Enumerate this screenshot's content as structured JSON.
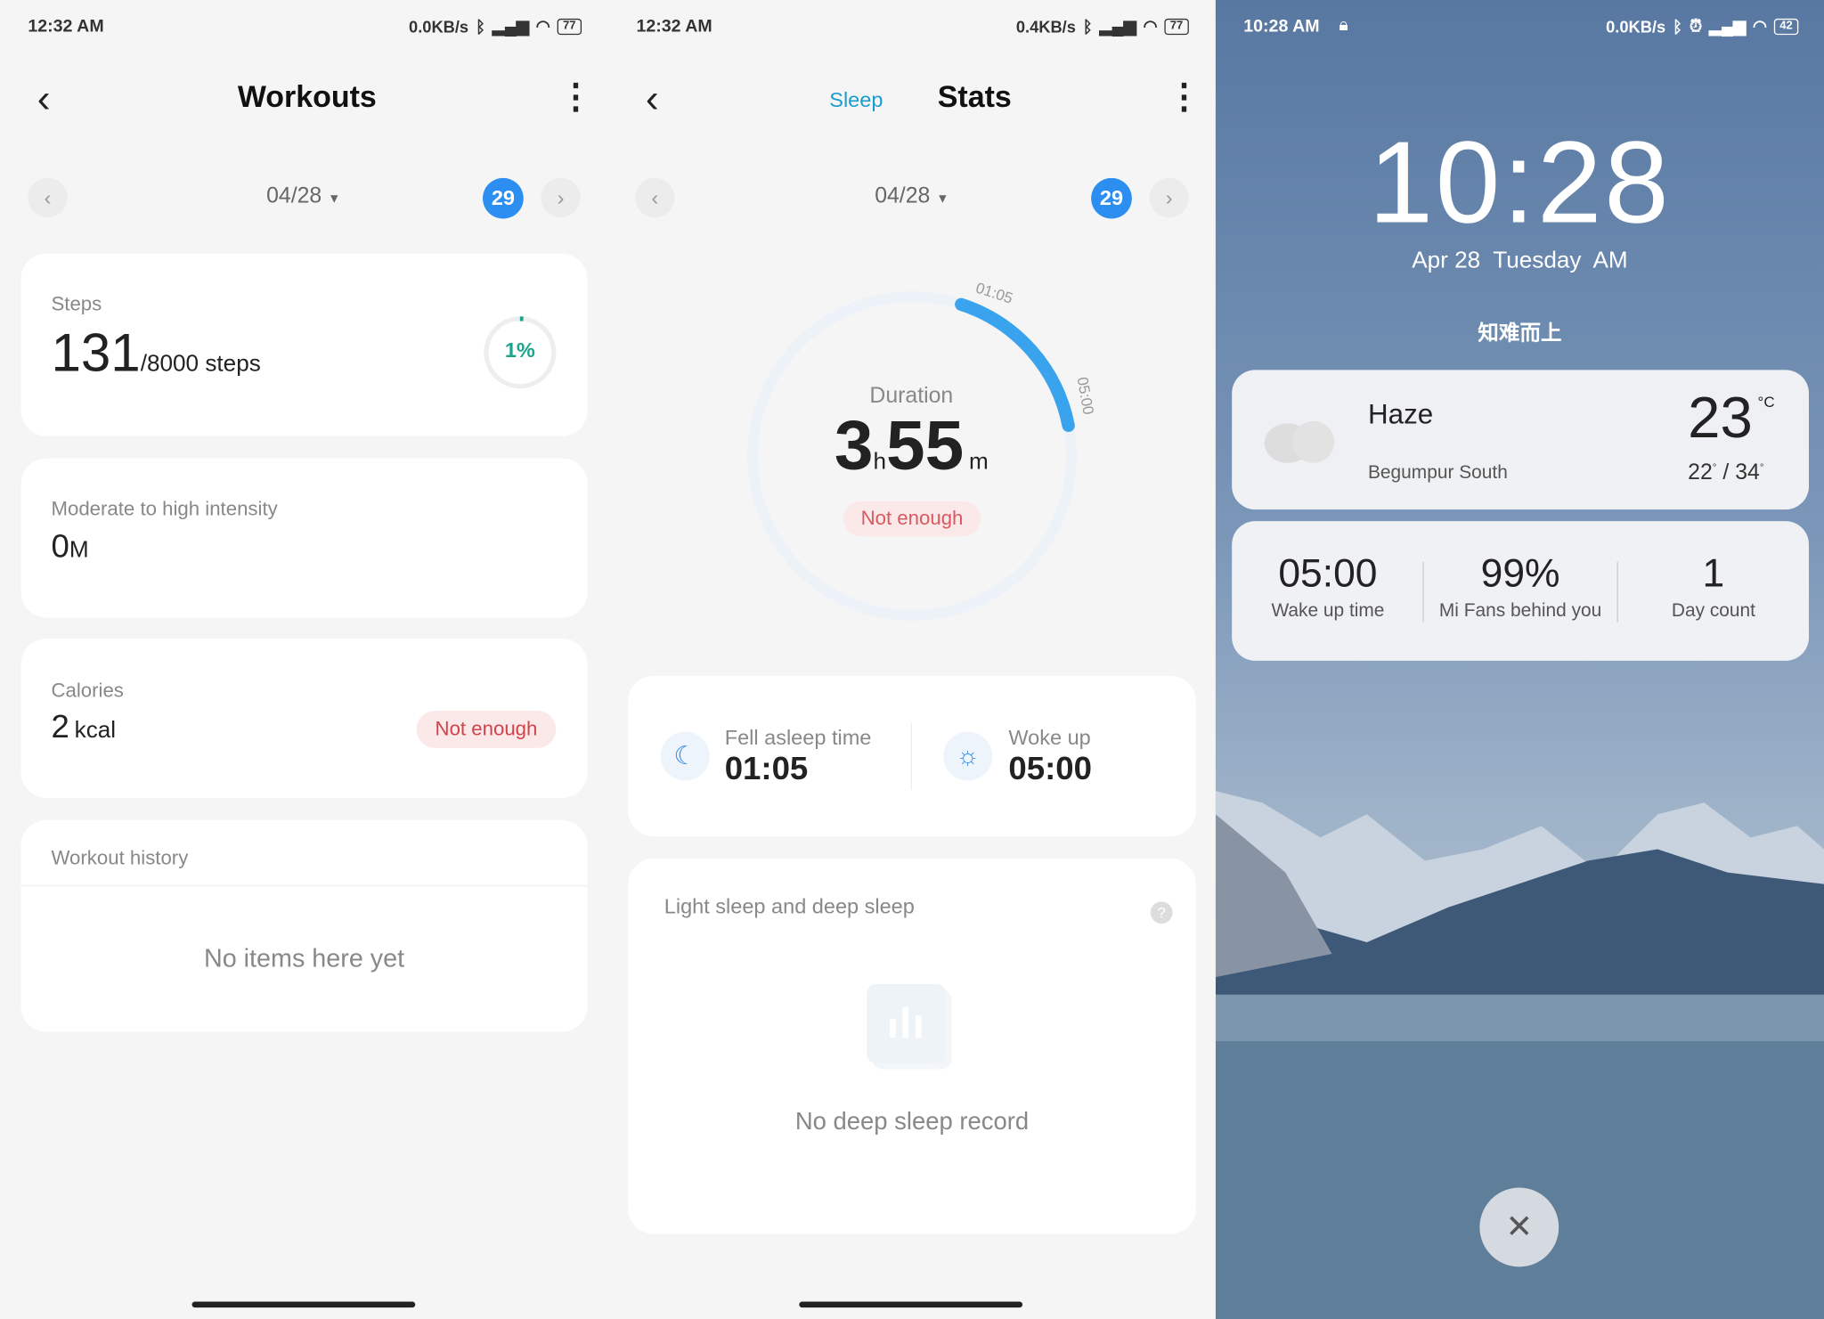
{
  "workouts": {
    "status": {
      "time": "12:32 AM",
      "speed": "0.0KB/s",
      "battery": "77"
    },
    "title": "Workouts",
    "date": "04/28",
    "day": "29",
    "steps": {
      "label": "Steps",
      "value": "131",
      "goal": "/8000 steps",
      "percent_label": "1%",
      "progress": 0.016
    },
    "intensity": {
      "label": "Moderate to high intensity",
      "value": "0",
      "unit": "M"
    },
    "calories": {
      "label": "Calories",
      "value": "2",
      "unit": "kcal",
      "badge": "Not enough"
    },
    "history": {
      "label": "Workout history",
      "empty": "No items here yet"
    }
  },
  "sleep": {
    "status": {
      "time": "12:32 AM",
      "speed": "0.4KB/s",
      "battery": "77"
    },
    "tab_sleep": "Sleep",
    "title": "Stats",
    "date": "04/28",
    "day": "29",
    "ring": {
      "start_label": "01:05",
      "end_label": "05:00",
      "duration_label": "Duration",
      "hours": "3",
      "h": "h",
      "minutes": "55",
      "m": "m",
      "badge": "Not enough"
    },
    "fell_asleep": {
      "label": "Fell asleep time",
      "value": "01:05"
    },
    "woke_up": {
      "label": "Woke up",
      "value": "05:00"
    },
    "deep": {
      "label": "Light sleep and deep sleep",
      "help": "?",
      "empty": "No deep sleep record"
    },
    "accent": "#2b8ef0"
  },
  "lock": {
    "status": {
      "time": "10:28 AM",
      "speed": "0.0KB/s",
      "battery": "42"
    },
    "clock": "10:28",
    "date": "Apr 28  Tuesday  AM",
    "motto": "知难而上",
    "weather": {
      "condition": "Haze",
      "location": "Begumpur South",
      "temp": "23",
      "unit": "°C",
      "low": "22",
      "high": "34",
      "deg": "°"
    },
    "stats": [
      {
        "value": "05:00",
        "label": "Wake up time"
      },
      {
        "value": "99%",
        "label": "Mi Fans behind you"
      },
      {
        "value": "1",
        "label": "Day count"
      }
    ],
    "close_icon": "close-icon"
  }
}
